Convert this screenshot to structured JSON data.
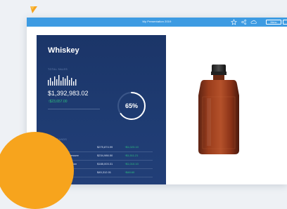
{
  "topbar": {
    "title": "My Presentation 2019",
    "menu_button": "Menu",
    "icons": [
      "star-icon",
      "share-icon",
      "cloud-icon"
    ]
  },
  "panel": {
    "title": "Whiskey",
    "sales_label": "TOTAL SALES",
    "total": "$1,392,983.02",
    "delta": "↑$23,657.00",
    "percent": "65%",
    "percent_value": 0.65,
    "brands_label": "TOP BRANDS",
    "rows": [
      {
        "name": "Bacon Fields",
        "amount": "$275,874.99",
        "change": "↑$1,023.10"
      },
      {
        "name": "Jack Daniel's Tennessee",
        "amount": "$234,986.50",
        "change": "↑$1,511.21"
      },
      {
        "name": "Crown Royal Canadian",
        "amount": "$188,003.31",
        "change": "↑$1,010.10"
      },
      {
        "name": "",
        "amount": "$45,312.01",
        "change": "↑$48.60"
      }
    ]
  },
  "colors": {
    "topbar": "#3d9be2",
    "panel": "#1f3c73",
    "accent_green": "#2ec27e",
    "blob": "#f7a41d"
  }
}
